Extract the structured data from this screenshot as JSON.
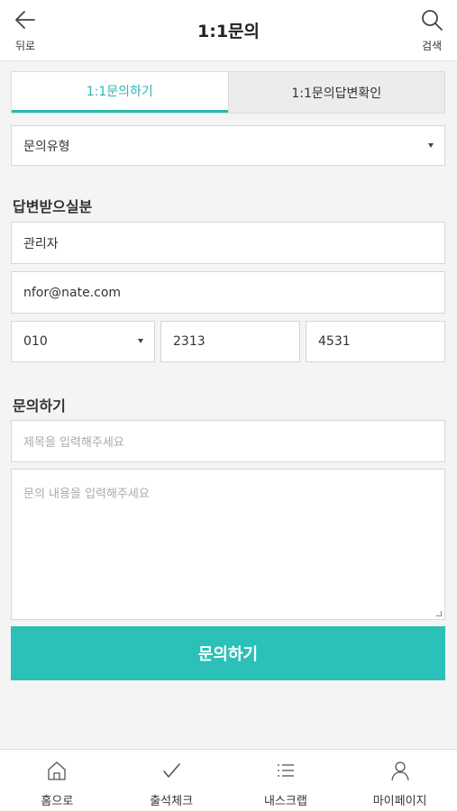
{
  "header": {
    "back_label": "뒤로",
    "title": "1:1문의",
    "search_label": "검색"
  },
  "tabs": [
    {
      "label": "1:1문의하기",
      "active": true
    },
    {
      "label": "1:1문의답변확인",
      "active": false
    }
  ],
  "inquiry_type": {
    "value": "문의유형"
  },
  "recipient_section": {
    "title": "답변받으실분",
    "name": "관리자",
    "email": "nfor@nate.com",
    "phone": {
      "prefix": "010",
      "middle": "2313",
      "last": "4531"
    }
  },
  "inquiry_section": {
    "title": "문의하기",
    "subject_placeholder": "제목을 입력해주세요",
    "content_placeholder": "문의 내용을 입력해주세요"
  },
  "submit_label": "문의하기",
  "bottom_nav": [
    {
      "label": "홈으로",
      "icon": "home-icon"
    },
    {
      "label": "출석체크",
      "icon": "check-icon"
    },
    {
      "label": "내스크랩",
      "icon": "list-icon"
    },
    {
      "label": "마이페이지",
      "icon": "person-icon"
    }
  ],
  "colors": {
    "accent": "#2bc0b8",
    "tab_active_text": "#2ab8b1",
    "background": "#f4f4f4"
  }
}
